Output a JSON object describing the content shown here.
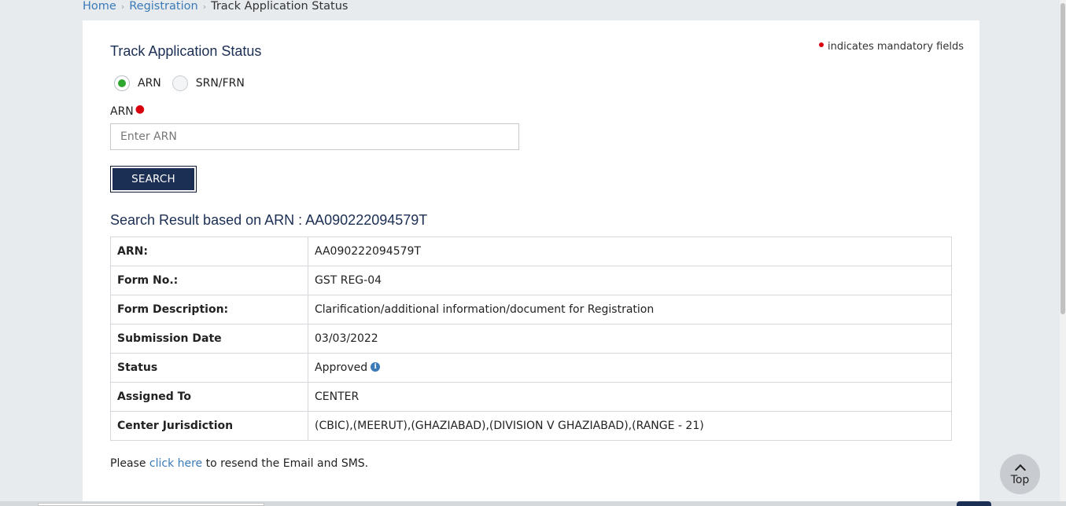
{
  "breadcrumb": {
    "home": "Home",
    "registration": "Registration",
    "current": "Track Application Status"
  },
  "panel": {
    "title": "Track Application Status",
    "mandatory_note": "indicates mandatory fields",
    "radio_options": [
      {
        "label": "ARN",
        "selected": true
      },
      {
        "label": "SRN/FRN",
        "selected": false
      }
    ],
    "arn_label": "ARN",
    "arn_placeholder": "Enter ARN",
    "arn_value": "",
    "search_label": "SEARCH",
    "result_title": "Search Result based on ARN : AA090222094579T"
  },
  "result_rows": [
    {
      "key": "ARN:",
      "value": "AA090222094579T"
    },
    {
      "key": "Form No.:",
      "value": "GST REG-04"
    },
    {
      "key": "Form Description:",
      "value": "Clarification/additional information/document for Registration"
    },
    {
      "key": "Submission Date",
      "value": "03/03/2022"
    },
    {
      "key": "Status",
      "value": "Approved"
    },
    {
      "key": "Assigned To",
      "value": "CENTER"
    },
    {
      "key": "Center Jurisdiction",
      "value": "(CBIC),(MEERUT),(GHAZIABAD),(DIVISION V GHAZIABAD),(RANGE - 21)"
    }
  ],
  "resend": {
    "prefix": "Please",
    "link": "click here",
    "suffix": "to resend the Email and SMS."
  },
  "top_button": {
    "label": "Top",
    "icon": "chevron-up-icon"
  },
  "icons": {
    "status_info": "info-icon"
  },
  "colors": {
    "primary": "#1b2e54",
    "link": "#3a7ab8",
    "mandatory": "#d9000d",
    "radio_selected": "#2fa62f"
  }
}
